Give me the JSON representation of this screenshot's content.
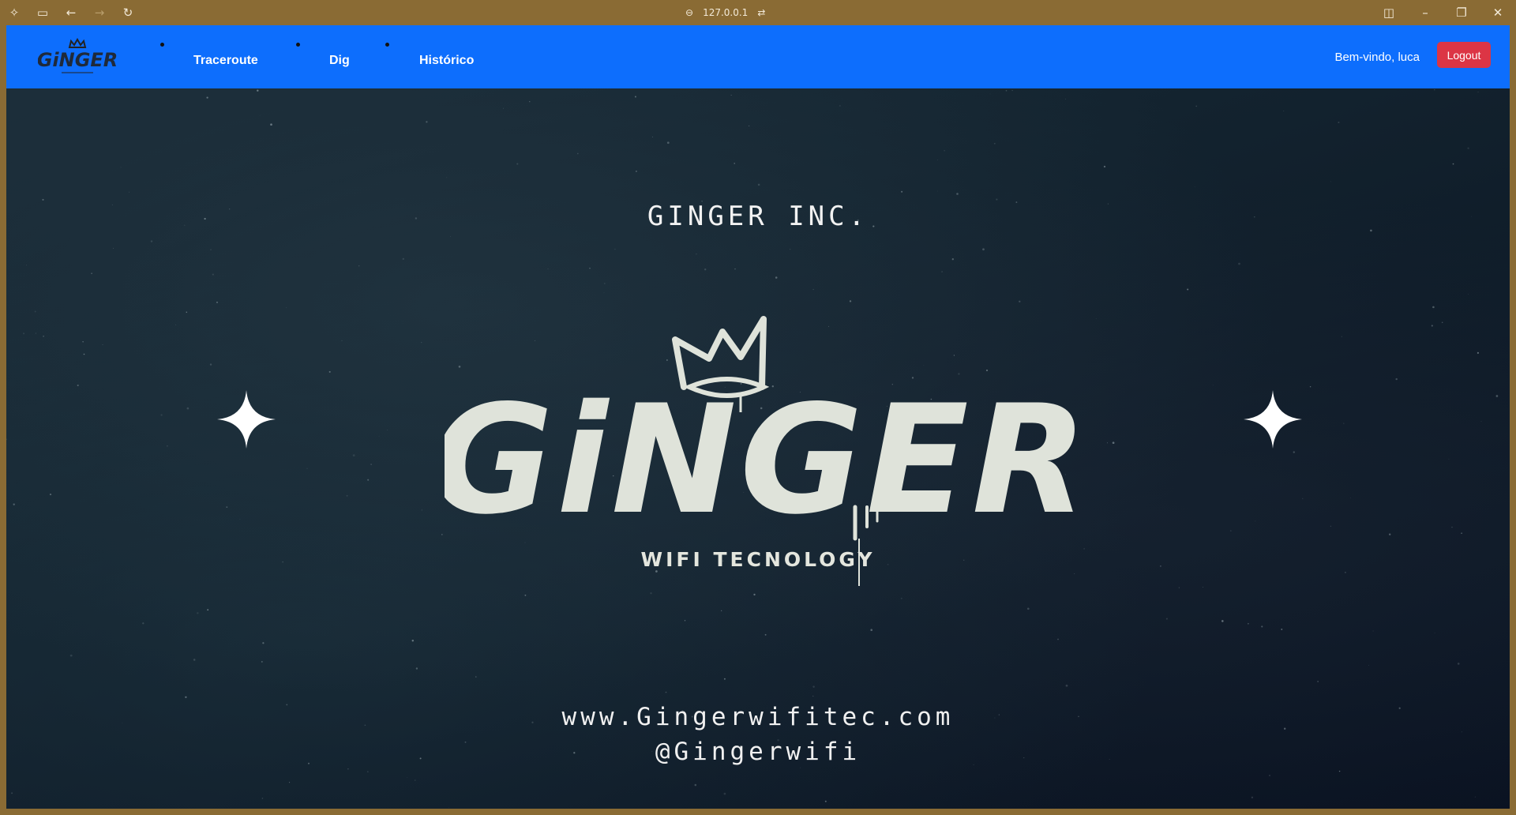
{
  "browser": {
    "address": "127.0.0.1",
    "icons": [
      "copilot-icon",
      "sidebar-icon",
      "back-icon",
      "forward-icon",
      "refresh-icon",
      "link-icon",
      "tune-icon",
      "split-view-icon",
      "minimize-icon",
      "restore-icon",
      "close-icon"
    ]
  },
  "navbar": {
    "brand": "GiNGER",
    "links": [
      "Traceroute",
      "Dig",
      "Histórico"
    ],
    "welcome": "Bem-vindo, luca",
    "logout_label": "Logout",
    "colors": {
      "navbar_bg": "#0d6efd",
      "logout_bg": "#dc3545"
    }
  },
  "hero": {
    "company": "GINGER INC.",
    "logo_text": "GiNGER",
    "tagline": "WIFI TECNOLOGY",
    "website": "www.Gingerwifitec.com",
    "handle": "@Gingerwifi"
  }
}
